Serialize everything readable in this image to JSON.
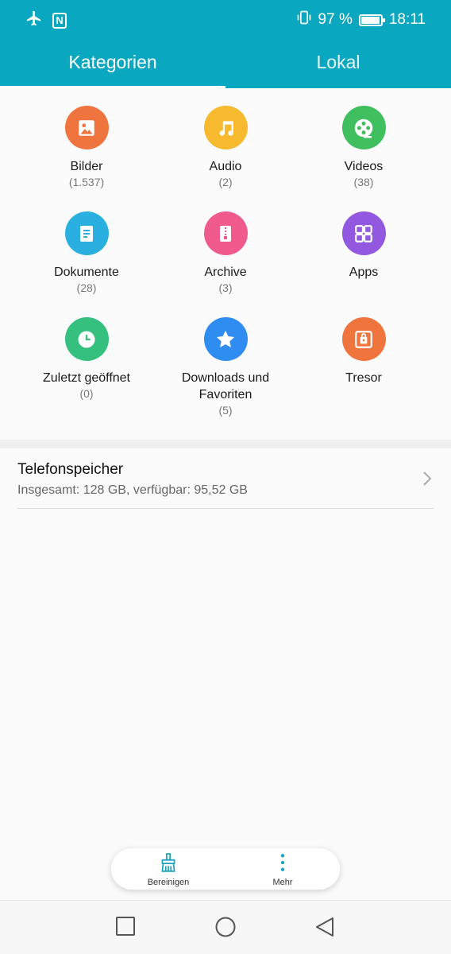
{
  "status_bar": {
    "battery": "97 %",
    "time": "18:11",
    "battery_level": 0.97,
    "icons": [
      "airplane-mode-icon",
      "nfc-icon",
      "vibrate-icon",
      "battery-icon"
    ]
  },
  "tabs": [
    {
      "label": "Kategorien",
      "active": true
    },
    {
      "label": "Lokal",
      "active": false
    }
  ],
  "categories": [
    {
      "label": "Bilder",
      "count": "(1.537)",
      "icon": "image-icon",
      "color": "#f0743e"
    },
    {
      "label": "Audio",
      "count": "(2)",
      "icon": "music-note-icon",
      "color": "#f7b92e"
    },
    {
      "label": "Videos",
      "count": "(38)",
      "icon": "film-reel-icon",
      "color": "#3fbf5e"
    },
    {
      "label": "Dokumente",
      "count": "(28)",
      "icon": "document-icon",
      "color": "#29b0e0"
    },
    {
      "label": "Archive",
      "count": "(3)",
      "icon": "archive-zip-icon",
      "color": "#f05a8c"
    },
    {
      "label": "Apps",
      "count": "",
      "icon": "apps-grid-icon",
      "color": "#9358e0"
    },
    {
      "label": "Zuletzt geöffnet",
      "count": "(0)",
      "icon": "clock-icon",
      "color": "#36c07f"
    },
    {
      "label": "Downloads und Favoriten",
      "count": "(5)",
      "icon": "star-icon",
      "color": "#2f8cf0"
    },
    {
      "label": "Tresor",
      "count": "",
      "icon": "safe-icon",
      "color": "#f0743e"
    }
  ],
  "storage": {
    "title": "Telefonspeicher",
    "subtitle": "Insgesamt: 128 GB, verfügbar: 95,52 GB"
  },
  "bottom_actions": {
    "clean_label": "Bereinigen",
    "more_label": "Mehr",
    "accent": "#1aa3bd"
  },
  "navbar": {
    "icons": [
      "recent-apps-square-icon",
      "home-circle-icon",
      "back-triangle-icon"
    ]
  },
  "colors": {
    "header": "#0aa8c0"
  }
}
